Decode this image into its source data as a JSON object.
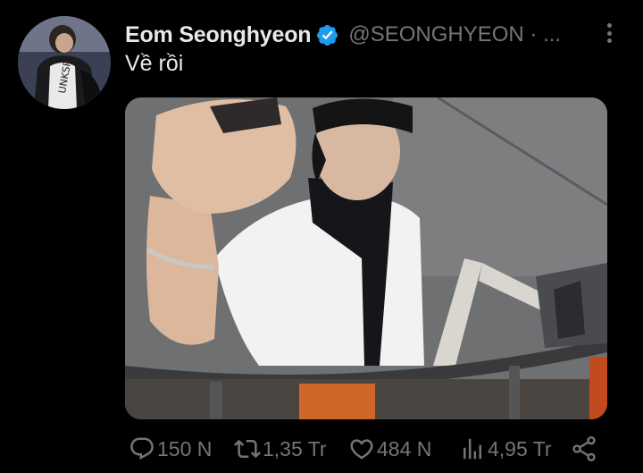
{
  "tweet": {
    "author": {
      "display_name": "Eom Seonghyeon",
      "handle": "@SEONGHYEON · ...",
      "verified": true,
      "avatar_icon": "profile-photo"
    },
    "text": "Về rồi",
    "media": {
      "kind": "photo"
    },
    "stats": {
      "replies": "150 N",
      "retweets": "1,35 Tr",
      "likes": "484 N",
      "views": "4,95 Tr"
    }
  },
  "colors": {
    "background": "#000000",
    "primary_text": "#e7e9ea",
    "secondary_text": "#71767b",
    "verified_badge": "#1d9bf0"
  },
  "icons": {
    "reply": "reply-icon",
    "retweet": "retweet-icon",
    "like": "heart-icon",
    "views": "views-icon",
    "share": "share-icon",
    "more": "more-icon",
    "verified": "verified-badge-icon"
  }
}
